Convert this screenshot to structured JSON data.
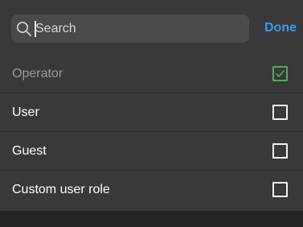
{
  "search": {
    "placeholder": "Search",
    "value": ""
  },
  "header": {
    "done_label": "Done"
  },
  "roles": [
    {
      "label": "Operator",
      "checked": true,
      "disabled": true
    },
    {
      "label": "User",
      "checked": false,
      "disabled": false
    },
    {
      "label": "Guest",
      "checked": false,
      "disabled": false
    },
    {
      "label": "Custom user role",
      "checked": false,
      "disabled": false
    }
  ],
  "colors": {
    "accent": "#3b9be8",
    "check": "#4caf50",
    "panel": "#393939",
    "background": "#232323"
  }
}
